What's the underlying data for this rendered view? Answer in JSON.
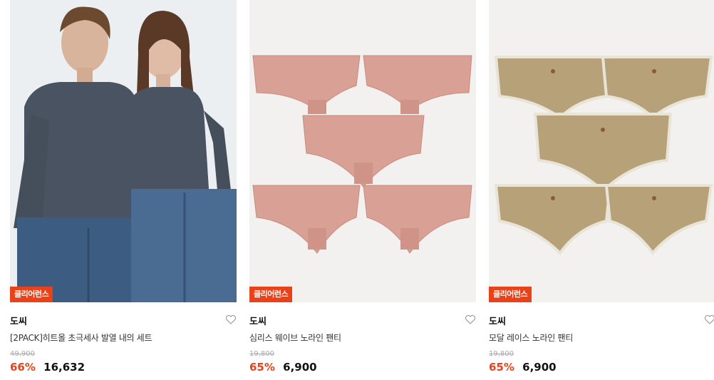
{
  "products": [
    {
      "badge": "클리어런스",
      "brand": "도씨",
      "title": "[2PACK]히트올 초극세사 발열 내의 세트",
      "original_price": "49,900",
      "discount": "66%",
      "price": "16,632",
      "image_icon": "couple-thermal-wear-photo"
    },
    {
      "badge": "클리어런스",
      "brand": "도씨",
      "title": "심리스 웨이브 노라인 팬티",
      "original_price": "19,800",
      "discount": "65%",
      "price": "6,900",
      "image_icon": "pink-panties-photo"
    },
    {
      "badge": "클리어런스",
      "brand": "도씨",
      "title": "모달 레이스 노라인 팬티",
      "original_price": "19,800",
      "discount": "65%",
      "price": "6,900",
      "image_icon": "beige-lace-panties-photo"
    }
  ],
  "colors": {
    "badge_bg": "#e8421a",
    "discount": "#e8421a",
    "pink_fabric": "#d9a195",
    "beige_fabric": "#b6a178",
    "shirt": "#4a5361",
    "jeans": "#3d5c82"
  },
  "icons": {
    "wishlist": "heart-outline-icon"
  }
}
